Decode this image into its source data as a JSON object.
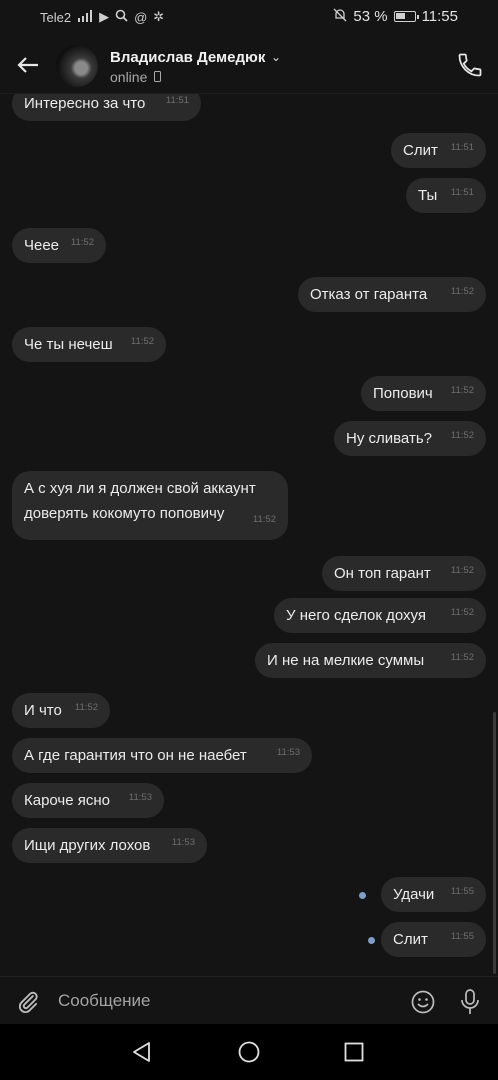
{
  "status_bar": {
    "carrier": "Tele2",
    "battery_percent": "53 %",
    "battery_level": 0.53,
    "time": "11:55"
  },
  "header": {
    "contact_name": "Владислав Демедюк",
    "status": "online"
  },
  "messages": [
    {
      "side": "in",
      "text": "Интересно за что",
      "time": "11:51"
    },
    {
      "side": "out",
      "text": "Слит",
      "time": "11:51"
    },
    {
      "side": "out",
      "text": "Ты",
      "time": "11:51"
    },
    {
      "side": "in",
      "text": "Чеее",
      "time": "11:52"
    },
    {
      "side": "out",
      "text": "Отказ от гаранта",
      "time": "11:52"
    },
    {
      "side": "in",
      "text": "Че ты нечеш",
      "time": "11:52"
    },
    {
      "side": "out",
      "text": "Попович",
      "time": "11:52"
    },
    {
      "side": "out",
      "text": "Ну сливать?",
      "time": "11:52"
    },
    {
      "side": "in",
      "text": "А с хуя ли я должен свой аккаунт\nдоверять кокомуто поповичу",
      "time": "11:52"
    },
    {
      "side": "out",
      "text": "Он топ гарант",
      "time": "11:52"
    },
    {
      "side": "out",
      "text": "У него сделок дохуя",
      "time": "11:52"
    },
    {
      "side": "out",
      "text": "И не на мелкие суммы",
      "time": "11:52"
    },
    {
      "side": "in",
      "text": "И что",
      "time": "11:52"
    },
    {
      "side": "in",
      "text": "А где гарантия что он не наебет",
      "time": "11:53"
    },
    {
      "side": "in",
      "text": "Кароче ясно",
      "time": "11:53"
    },
    {
      "side": "in",
      "text": "Ищи других лохов",
      "time": "11:53"
    },
    {
      "side": "out",
      "text": "Удачи",
      "time": "11:55",
      "unread": true
    },
    {
      "side": "out",
      "text": "Слит",
      "time": "11:55",
      "unread": true
    }
  ],
  "composer": {
    "placeholder": "Сообщение"
  },
  "colors": {
    "background": "#141414",
    "bubble": "#2a2a2a",
    "unread_dot": "#7f9dc9"
  },
  "icons": [
    "back-arrow-icon",
    "phone-icon",
    "attach-icon",
    "emoji-icon",
    "mic-icon",
    "nav-back-icon",
    "nav-home-icon",
    "nav-recent-icon"
  ]
}
